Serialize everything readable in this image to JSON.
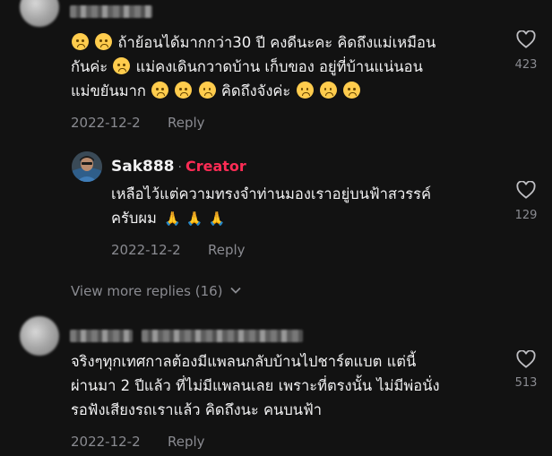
{
  "comments": [
    {
      "lines": [
        [
          "emoji",
          "emoji",
          " ถ้าย้อนได้มากกว่า30 ปี คงดีนะคะ คิดถึงแม่เหมือน"
        ],
        [
          "กันค่ะ ",
          "emoji",
          " แม่คงเดินกวาดบ้าน เก็บของ อยู่ที่บ้านแน่นอน"
        ],
        [
          "แม่ขยันมาก ",
          "emoji",
          "emoji",
          "emoji",
          "  คิดถึงจังค่ะ ",
          "emoji",
          "emoji",
          "emoji"
        ]
      ],
      "date": "2022-12-2",
      "reply_label": "Reply",
      "likes": "423"
    },
    {
      "username": "Sak888",
      "separator": "·",
      "badge": "Creator",
      "line1": "เหลือไว้แต่ความทรงจำท่านมองเราอยู่บนฟ้าสวรรค์",
      "line2_text": "ครับผม",
      "pray": "🙏",
      "date": "2022-12-2",
      "reply_label": "Reply",
      "likes": "129"
    },
    {
      "lines": [
        "จริงๆทุกเทศกาลต้องมีแพลนกลับบ้านไปชาร์ตแบต แต่นี้",
        "ผ่านมา 2 ปีแล้ว ที่ไม่มีแพลนเลย เพราะที่ตรงนั้น ไม่มีพ่อนั่ง",
        "รอฟังเสียงรถเราแล้ว คิดถึงนะ คนบนฟ้า"
      ],
      "date": "2022-12-2",
      "reply_label": "Reply",
      "likes": "513"
    }
  ],
  "view_more": "View more replies (16)",
  "icons": {
    "like": "heart-outline-icon",
    "expand": "chevron-down-icon"
  },
  "colors": {
    "background": "#121212",
    "creator": "#fe2c55",
    "muted": "#8a8b91",
    "text": "#f1f1f2"
  }
}
